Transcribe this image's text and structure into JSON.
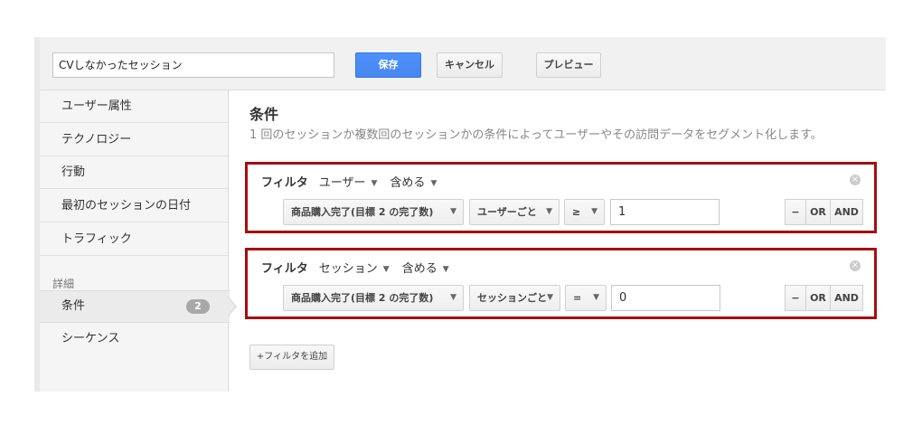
{
  "header": {
    "segment_name": "CVしなかったセッション",
    "save_label": "保存",
    "cancel_label": "キャンセル",
    "preview_label": "プレビュー"
  },
  "sidebar": {
    "items": [
      {
        "label": "ユーザー属性"
      },
      {
        "label": "テクノロジー"
      },
      {
        "label": "行動"
      },
      {
        "label": "最初のセッションの日付"
      },
      {
        "label": "トラフィック"
      }
    ],
    "section_label": "詳細",
    "advanced_items": [
      {
        "label": "条件",
        "badge": "2",
        "active": true
      },
      {
        "label": "シーケンス"
      }
    ]
  },
  "main": {
    "title": "条件",
    "description": "1 回のセッションか複数回のセッションかの条件によってユーザーやその訪問データをセグメント化します。",
    "filters": [
      {
        "label": "フィルタ",
        "scope": "ユーザー",
        "include": "含める",
        "metric": "商品購入完了(目標 2 の完了数)",
        "per": "ユーザーごと",
        "operator": "≥",
        "value": "1"
      },
      {
        "label": "フィルタ",
        "scope": "セッション",
        "include": "含める",
        "metric": "商品購入完了(目標 2 の完了数)",
        "per": "セッションごと",
        "operator": "=",
        "value": "0"
      }
    ],
    "minus_label": "−",
    "or_label": "OR",
    "and_label": "AND",
    "add_filter_label": "+フィルタを追加"
  },
  "colors": {
    "highlight": "#a80d0d",
    "save_button": "#4d90fe",
    "badge": "#a8a8a8"
  },
  "icons": {
    "remove_filter": "close-circle-icon",
    "dropdown": "caret-down-icon"
  }
}
